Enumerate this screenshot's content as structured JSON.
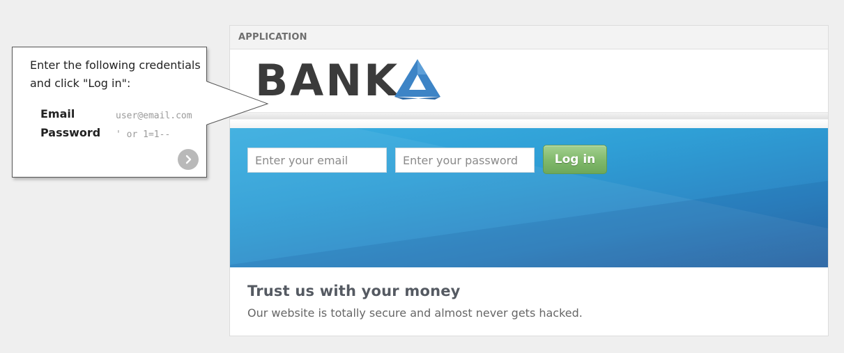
{
  "app": {
    "header": "APPLICATION",
    "logo_text": "BANK",
    "login_form": {
      "email_placeholder": "Enter your email",
      "password_placeholder": "Enter your password",
      "login_label": "Log in"
    },
    "content": {
      "title": "Trust us with your money",
      "text": "Our website is totally secure and almost never gets hacked."
    }
  },
  "callout": {
    "instruction": "Enter the following credentials and click \"Log in\":",
    "credentials": [
      {
        "label": "Email",
        "value": "user@email.com"
      },
      {
        "label": "Password",
        "value": "' or 1=1--"
      }
    ],
    "next_icon": "chevron-right-icon"
  },
  "colors": {
    "hero_blue": "#2f9fd6",
    "login_green": "#7fb86a",
    "logo_blue": "#3d84c6"
  }
}
